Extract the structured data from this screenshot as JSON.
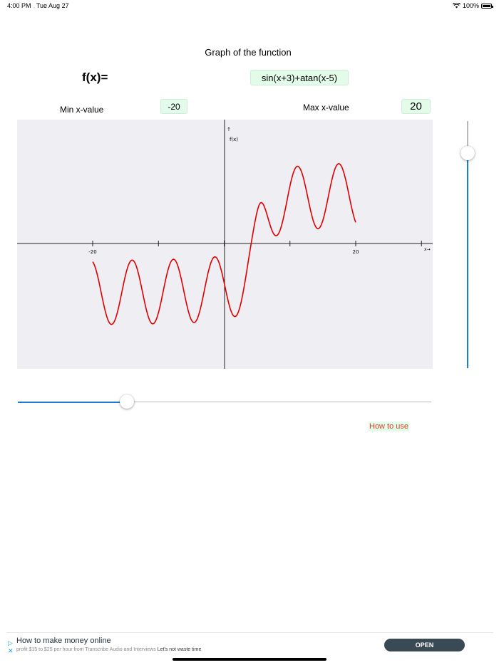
{
  "status_bar": {
    "time": "4:00 PM",
    "date": "Tue Aug 27",
    "battery": "100%",
    "wifi_icon": "wifi-icon",
    "battery_icon": "battery-icon"
  },
  "header": {
    "title": "Graph of the function"
  },
  "function": {
    "label": "f(x)=",
    "expression": "sin(x+3)+atan(x-5)"
  },
  "range": {
    "min_label": "Min x-value",
    "min_value": "-20",
    "max_label": "Max x-value",
    "max_value": "20"
  },
  "graph": {
    "y_axis_label": "f(x)",
    "x_axis_label": "x",
    "arrow_up": "↑",
    "arrow_right": "→",
    "tick_min_label": "-20",
    "tick_max_label": "20",
    "x_min": -20,
    "x_max": 20,
    "curve_color": "#e00000",
    "background": "#efeef3"
  },
  "sliders": {
    "vertical_value": 0.86,
    "horizontal_value": 0.26
  },
  "help": {
    "link_label": "How to use"
  },
  "ad": {
    "title": "How to make money online",
    "body": "profit $15 to $25 per hour from Transcribe Audio and Interviews",
    "body_highlight": "Let's not waste time",
    "button_label": "OPEN"
  }
}
